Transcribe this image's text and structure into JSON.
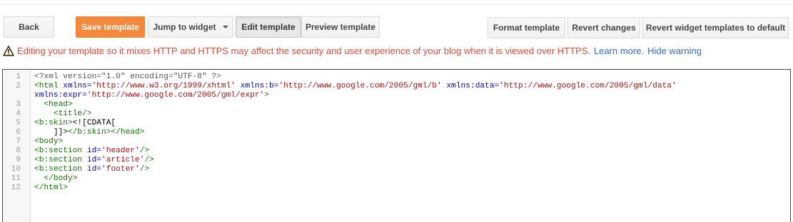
{
  "toolbar": {
    "back": "Back",
    "save": "Save template",
    "jump": "Jump to widget",
    "edit": "Edit template",
    "preview": "Preview template",
    "format": "Format template",
    "revert": "Revert changes",
    "revert_widgets": "Revert widget templates to default"
  },
  "warning": {
    "text": "Editing your template so it mixes HTTP and HTTPS may affect the security and user experience of your blog when it is viewed over HTTPS.",
    "learn_more": "Learn more.",
    "hide": "Hide warning"
  },
  "editor": {
    "line_numbers": [
      "1",
      "2",
      "",
      "3",
      "4",
      "5",
      "6",
      "7",
      "8",
      "9",
      "10",
      "11",
      "12"
    ],
    "lines": [
      [
        {
          "c": "meta",
          "t": "<?xml version=\"1.0\" encoding=\"UTF-8\" ?>"
        }
      ],
      [
        {
          "c": "tag",
          "t": "<html "
        },
        {
          "c": "attr",
          "t": "xmlns="
        },
        {
          "c": "str",
          "t": "'http://www.w3.org/1999/xhtml'"
        },
        {
          "c": "plain",
          "t": " "
        },
        {
          "c": "attr",
          "t": "xmlns:b="
        },
        {
          "c": "str",
          "t": "'http://www.google.com/2005/gml/b'"
        },
        {
          "c": "plain",
          "t": " "
        },
        {
          "c": "attr",
          "t": "xmlns:data="
        },
        {
          "c": "str",
          "t": "'http://www.google.com/2005/gml/data'"
        }
      ],
      [
        {
          "c": "attr",
          "t": "xmlns:expr="
        },
        {
          "c": "str",
          "t": "'http://www.google.com/2005/gml/expr'"
        },
        {
          "c": "tag",
          "t": ">"
        }
      ],
      [
        {
          "c": "tag",
          "t": "  <head>"
        }
      ],
      [
        {
          "c": "tag",
          "t": "    <title/>"
        }
      ],
      [
        {
          "c": "tag",
          "t": "<b:skin>"
        },
        {
          "c": "plain",
          "t": "<![CDATA["
        }
      ],
      [
        {
          "c": "plain",
          "t": "    ]]>"
        },
        {
          "c": "tag",
          "t": "</b:skin></head>"
        }
      ],
      [
        {
          "c": "tag",
          "t": "<body>"
        }
      ],
      [
        {
          "c": "tag",
          "t": "<b:section "
        },
        {
          "c": "attr",
          "t": "id="
        },
        {
          "c": "str",
          "t": "'header'"
        },
        {
          "c": "tag",
          "t": "/>"
        }
      ],
      [
        {
          "c": "tag",
          "t": "<b:section "
        },
        {
          "c": "attr",
          "t": "id="
        },
        {
          "c": "str",
          "t": "'article'"
        },
        {
          "c": "tag",
          "t": "/>"
        }
      ],
      [
        {
          "c": "tag",
          "t": "<b:section "
        },
        {
          "c": "attr",
          "t": "id="
        },
        {
          "c": "str",
          "t": "'footer'"
        },
        {
          "c": "tag",
          "t": "/>"
        }
      ],
      [
        {
          "c": "tag",
          "t": "  </body>"
        }
      ],
      [
        {
          "c": "tag",
          "t": "</html>"
        }
      ]
    ]
  }
}
